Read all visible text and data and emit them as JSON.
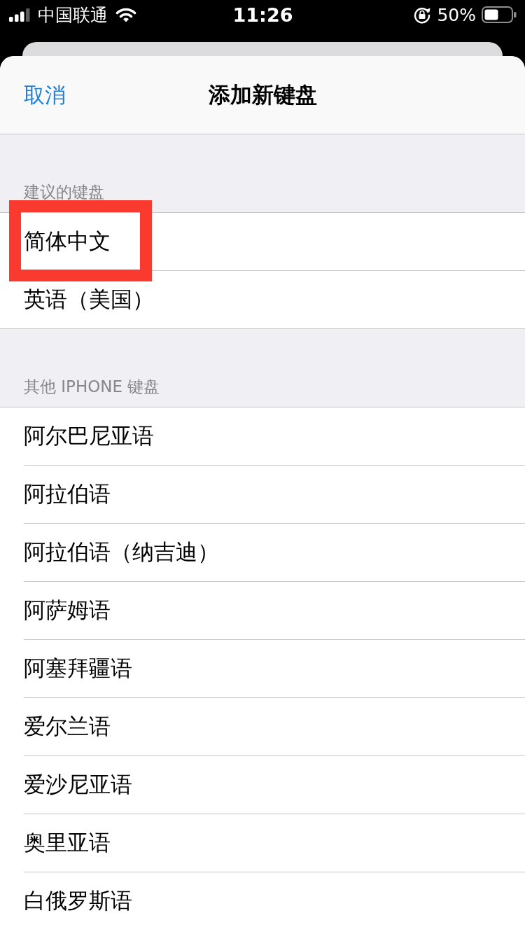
{
  "status_bar": {
    "carrier": "中国联通",
    "time": "11:26",
    "battery_percent": "50%"
  },
  "nav_bar": {
    "cancel": "取消",
    "title": "添加新键盘"
  },
  "sections": [
    {
      "header": "建议的键盘",
      "items": [
        {
          "label": "简体中文",
          "highlighted": true
        },
        {
          "label": "英语（美国）",
          "highlighted": false
        }
      ]
    },
    {
      "header": "其他 IPHONE 键盘",
      "items": [
        {
          "label": "阿尔巴尼亚语",
          "highlighted": false
        },
        {
          "label": "阿拉伯语",
          "highlighted": false
        },
        {
          "label": "阿拉伯语（纳吉迪）",
          "highlighted": false
        },
        {
          "label": "阿萨姆语",
          "highlighted": false
        },
        {
          "label": "阿塞拜疆语",
          "highlighted": false
        },
        {
          "label": "爱尔兰语",
          "highlighted": false
        },
        {
          "label": "爱沙尼亚语",
          "highlighted": false
        },
        {
          "label": "奥里亚语",
          "highlighted": false
        },
        {
          "label": "白俄罗斯语",
          "highlighted": false
        }
      ]
    }
  ]
}
